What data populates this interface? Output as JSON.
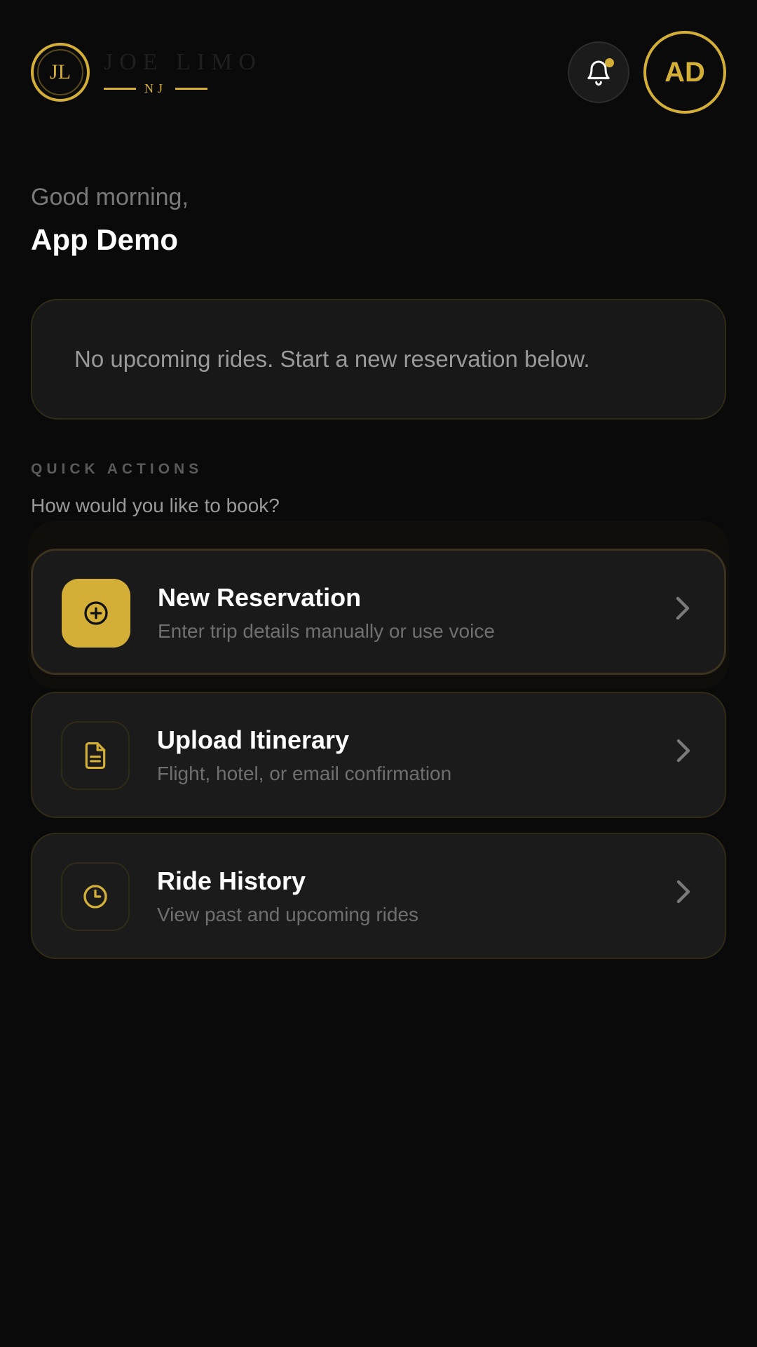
{
  "brand": {
    "monogram": "JL",
    "name": "JOE LIMO",
    "region": "NJ",
    "accent_color": "#d4af37"
  },
  "header": {
    "notification_icon": "bell-icon",
    "has_unread": true,
    "avatar_initials": "AD"
  },
  "greeting": {
    "salutation": "Good morning,",
    "user_name": "App Demo"
  },
  "upcoming": {
    "empty_message": "No upcoming rides. Start a new reservation below."
  },
  "quick_actions": {
    "label": "QUICK ACTIONS",
    "subtitle": "How would you like to book?",
    "items": [
      {
        "title": "New Reservation",
        "description": "Enter trip details manually or use voice",
        "icon": "plus-circle-icon"
      },
      {
        "title": "Upload Itinerary",
        "description": "Flight, hotel, or email confirmation",
        "icon": "document-icon"
      },
      {
        "title": "Ride History",
        "description": "View past and upcoming rides",
        "icon": "clock-icon"
      }
    ]
  }
}
